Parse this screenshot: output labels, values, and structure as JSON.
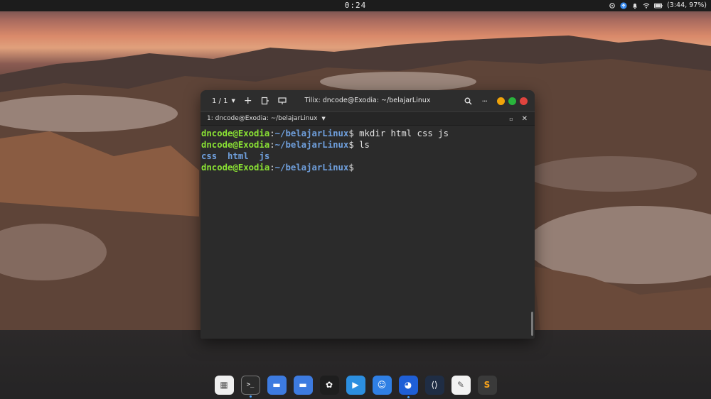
{
  "topbar": {
    "clock": "0:24",
    "battery": "(3:44, 97%)"
  },
  "window": {
    "tab_count": "1 / 1",
    "title": "Tilix: dncode@Exodia: ~/belajarLinux",
    "session_label": "1: dncode@Exodia: ~/belajarLinux",
    "controls": {
      "close_color": "#e0443e",
      "maximize_color": "#29b43c",
      "minimize_color": "#f0a30a"
    }
  },
  "terminal": {
    "user_host": "dncode@Exodia",
    "colon": ":",
    "path": "~/belajarLinux",
    "prompt_sign": "$",
    "commands": [
      "mkdir html css js",
      "ls"
    ],
    "ls_output": [
      "css",
      "html",
      "js"
    ]
  },
  "dock": {
    "apps": [
      {
        "name": "calculator",
        "icon": "calculator-icon",
        "color": "#efefef",
        "glyph": "▦",
        "running": false
      },
      {
        "name": "terminal",
        "icon": "terminal-icon",
        "color": "#2b2b2b",
        "glyph": ">_",
        "running": true
      },
      {
        "name": "files",
        "icon": "folder-icon",
        "color": "#3d7be0",
        "glyph": "▬",
        "running": false
      },
      {
        "name": "files-2",
        "icon": "folder-icon",
        "color": "#3d7be0",
        "glyph": "▬",
        "running": false
      },
      {
        "name": "figma",
        "icon": "figma-icon",
        "color": "#1e1e1e",
        "glyph": "✿",
        "running": false
      },
      {
        "name": "media-player",
        "icon": "play-icon",
        "color": "#2c8fe0",
        "glyph": "▶",
        "running": false
      },
      {
        "name": "finder",
        "icon": "finder-icon",
        "color": "#2f7fe4",
        "glyph": "☺",
        "running": false
      },
      {
        "name": "firefox",
        "icon": "firefox-icon",
        "color": "#1f5fd6",
        "glyph": "◕",
        "running": true
      },
      {
        "name": "vscode",
        "icon": "vscode-icon",
        "color": "#1f2d44",
        "glyph": "⟨⟩",
        "running": false
      },
      {
        "name": "text-editor",
        "icon": "text-editor-icon",
        "color": "#f2f2f2",
        "glyph": "✎",
        "running": false
      },
      {
        "name": "sublime-text",
        "icon": "sublime-icon",
        "color": "#3a3a3a",
        "glyph": "S",
        "running": false
      }
    ]
  }
}
